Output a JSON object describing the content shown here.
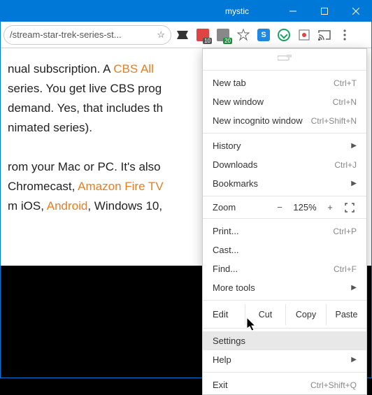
{
  "window": {
    "title": "mystic"
  },
  "url": "/stream-star-trek-series-st...",
  "extensions": {
    "badge1": "10",
    "badge2": "20"
  },
  "article": {
    "line1a": "nual subscription. A ",
    "line1b": "CBS All ",
    "line2": " series. You get live CBS prog",
    "line3": "demand. Yes, that includes th",
    "line4": "nimated series).",
    "line5": "rom your Mac or PC. It's also ",
    "line6a": " Chromecast, ",
    "line6b": "Amazon Fire TV",
    "line7a": "m iOS, ",
    "line7b": "Android",
    "line7c": ", Windows 10, "
  },
  "menu": {
    "newTab": {
      "label": "New tab",
      "shortcut": "Ctrl+T"
    },
    "newWindow": {
      "label": "New window",
      "shortcut": "Ctrl+N"
    },
    "newIncognito": {
      "label": "New incognito window",
      "shortcut": "Ctrl+Shift+N"
    },
    "history": {
      "label": "History"
    },
    "downloads": {
      "label": "Downloads",
      "shortcut": "Ctrl+J"
    },
    "bookmarks": {
      "label": "Bookmarks"
    },
    "zoom": {
      "label": "Zoom",
      "value": "125%"
    },
    "print": {
      "label": "Print...",
      "shortcut": "Ctrl+P"
    },
    "cast": {
      "label": "Cast..."
    },
    "find": {
      "label": "Find...",
      "shortcut": "Ctrl+F"
    },
    "moreTools": {
      "label": "More tools"
    },
    "edit": {
      "label": "Edit",
      "cut": "Cut",
      "copy": "Copy",
      "paste": "Paste"
    },
    "settings": {
      "label": "Settings"
    },
    "help": {
      "label": "Help"
    },
    "exit": {
      "label": "Exit",
      "shortcut": "Ctrl+Shift+Q"
    }
  }
}
